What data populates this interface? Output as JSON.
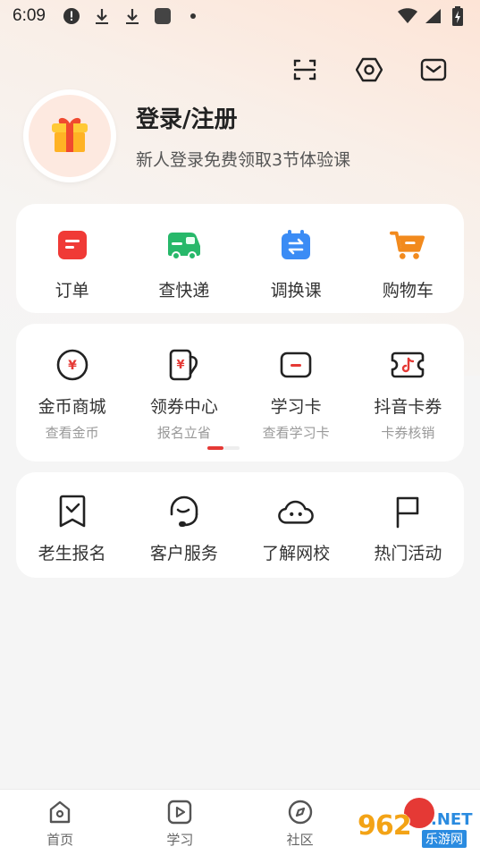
{
  "status_bar": {
    "time": "6:09"
  },
  "profile": {
    "title": "登录/注册",
    "subtitle": "新人登录免费领取3节体验课"
  },
  "quick_actions": [
    {
      "label": "订单",
      "icon": "order-icon"
    },
    {
      "label": "查快递",
      "icon": "truck-icon"
    },
    {
      "label": "调换课",
      "icon": "exchange-icon"
    },
    {
      "label": "购物车",
      "icon": "cart-icon"
    }
  ],
  "services": [
    {
      "label": "金币商城",
      "sub": "查看金币",
      "icon": "coin-icon"
    },
    {
      "label": "领券中心",
      "sub": "报名立省",
      "icon": "coupon-icon"
    },
    {
      "label": "学习卡",
      "sub": "查看学习卡",
      "icon": "card-icon"
    },
    {
      "label": "抖音卡券",
      "sub": "卡券核销",
      "icon": "tiktok-ticket-icon"
    }
  ],
  "more": [
    {
      "label": "老生报名",
      "icon": "bookmark-check-icon"
    },
    {
      "label": "客户服务",
      "icon": "headset-icon"
    },
    {
      "label": "了解网校",
      "icon": "cloud-face-icon"
    },
    {
      "label": "热门活动",
      "icon": "flag-icon"
    }
  ],
  "bottom_nav": [
    {
      "label": "首页",
      "icon": "home-icon"
    },
    {
      "label": "学习",
      "icon": "play-icon"
    },
    {
      "label": "社区",
      "icon": "compass-icon"
    }
  ],
  "watermark": {
    "text": "962",
    "net": ".NET",
    "sub": "乐游网"
  },
  "colors": {
    "accent": "#e53935",
    "green": "#2bbf6a",
    "blue": "#3b8cf5",
    "orange": "#f28a1d"
  }
}
